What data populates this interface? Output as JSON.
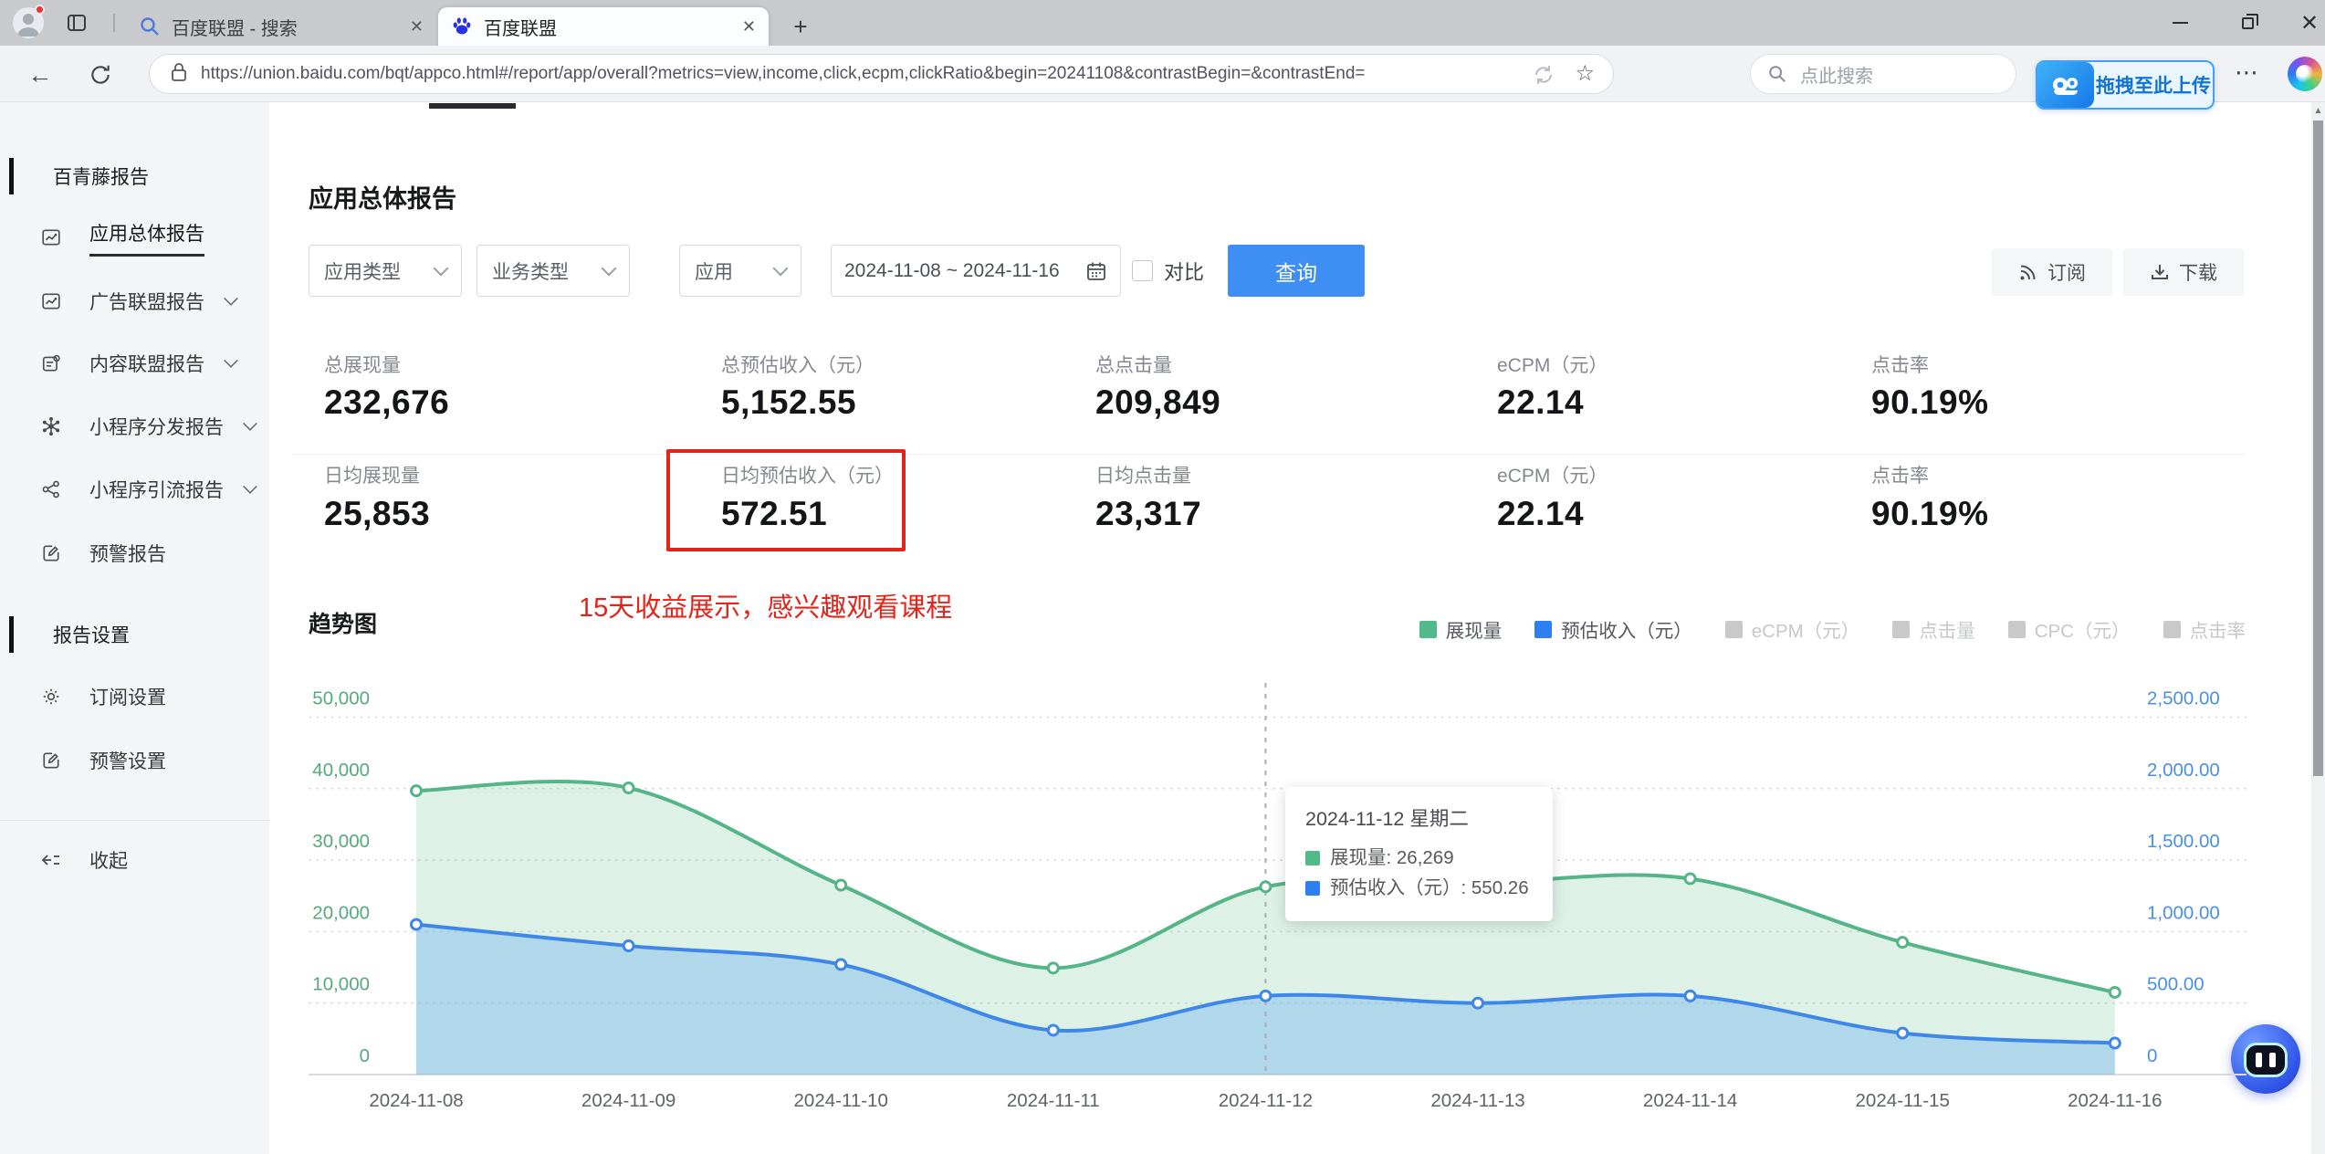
{
  "browser": {
    "tabs": [
      {
        "title": "百度联盟 - 搜索"
      },
      {
        "title": "百度联盟"
      }
    ],
    "url": "https://union.baidu.com/bqt/appco.html#/report/app/overall?metrics=view,income,click,ecpm,clickRatio&begin=20241108&contrastBegin=&contrastEnd=",
    "search_placeholder": "点此搜索",
    "netdisk_button": "拖拽至此上传"
  },
  "sidebar": {
    "sections": [
      {
        "header": "百青藤报告",
        "items": [
          {
            "label": "应用总体报告",
            "icon": "report-chart",
            "active": true,
            "expandable": false
          },
          {
            "label": "广告联盟报告",
            "icon": "report-chart",
            "active": false,
            "expandable": true
          },
          {
            "label": "内容联盟报告",
            "icon": "content-doc",
            "active": false,
            "expandable": true
          },
          {
            "label": "小程序分发报告",
            "icon": "network",
            "active": false,
            "expandable": true
          },
          {
            "label": "小程序引流报告",
            "icon": "share",
            "active": false,
            "expandable": true
          },
          {
            "label": "预警报告",
            "icon": "alert-edit",
            "active": false,
            "expandable": false
          }
        ]
      },
      {
        "header": "报告设置",
        "items": [
          {
            "label": "订阅设置",
            "icon": "gear",
            "active": false,
            "expandable": false
          },
          {
            "label": "预警设置",
            "icon": "alert-edit",
            "active": false,
            "expandable": false
          }
        ]
      }
    ],
    "collapse_label": "收起"
  },
  "main": {
    "title": "应用总体报告",
    "filters": {
      "app_type": "应用类型",
      "biz_type": "业务类型",
      "app": "应用",
      "date_range": "2024-11-08 ~ 2024-11-16",
      "contrast_label": "对比",
      "query_button": "查询"
    },
    "actions": {
      "subscribe": "订阅",
      "download": "下载"
    },
    "stats": {
      "rows": [
        [
          {
            "label": "总展现量",
            "value": "232,676"
          },
          {
            "label": "总预估收入（元）",
            "value": "5,152.55"
          },
          {
            "label": "总点击量",
            "value": "209,849"
          },
          {
            "label": "eCPM（元）",
            "value": "22.14"
          },
          {
            "label": "点击率",
            "value": "90.19%"
          }
        ],
        [
          {
            "label": "日均展现量",
            "value": "25,853"
          },
          {
            "label": "日均预估收入（元）",
            "value": "572.51",
            "highlighted": true
          },
          {
            "label": "日均点击量",
            "value": "23,317"
          },
          {
            "label": "eCPM（元）",
            "value": "22.14"
          },
          {
            "label": "点击率",
            "value": "90.19%"
          }
        ]
      ]
    },
    "annotation": "15天收益展示，感兴趣观看课程",
    "chart_title": "趋势图"
  },
  "chart_data": {
    "type": "area",
    "title": "趋势图",
    "x": [
      "2024-11-08",
      "2024-11-09",
      "2024-11-10",
      "2024-11-11",
      "2024-11-12",
      "2024-11-13",
      "2024-11-14",
      "2024-11-15",
      "2024-11-16"
    ],
    "series": [
      {
        "name": "展现量",
        "axis": "left",
        "color": "#55b588",
        "fill": "rgba(102,190,146,0.22)",
        "values": [
          39700,
          40100,
          26500,
          14900,
          26269,
          26800,
          27400,
          18500,
          11500
        ]
      },
      {
        "name": "预估收入（元）",
        "axis": "right",
        "color": "#3e87e8",
        "fill": "rgba(125,185,240,0.45)",
        "values": [
          1050,
          900,
          770,
          310,
          550.26,
          500,
          550,
          290,
          220
        ]
      }
    ],
    "left_axis": {
      "min": 0,
      "max": 50000,
      "step": 10000,
      "labels": [
        "0",
        "10,000",
        "20,000",
        "30,000",
        "40,000",
        "50,000"
      ],
      "color": "#55a97c"
    },
    "right_axis": {
      "min": 0,
      "max": 2500,
      "step": 500,
      "labels": [
        "0",
        "500.00",
        "1,000.00",
        "1,500.00",
        "2,000.00",
        "2,500.00"
      ],
      "color": "#4a90e2"
    },
    "grid": "dotted horizontal",
    "legend_position": "top-right",
    "legend": [
      {
        "label": "展现量",
        "color": "#52b98a",
        "active": true
      },
      {
        "label": "预估收入（元）",
        "color": "#2e7ff0",
        "active": true
      },
      {
        "label": "eCPM（元）",
        "color": "#c9c9c9",
        "active": false
      },
      {
        "label": "点击量",
        "color": "#c9c9c9",
        "active": false
      },
      {
        "label": "CPC（元）",
        "color": "#c9c9c9",
        "active": false
      },
      {
        "label": "点击率",
        "color": "#c9c9c9",
        "active": false
      }
    ],
    "tooltip": {
      "title": "2024-11-12 星期二",
      "anchor_index": 4,
      "rows": [
        {
          "text": "展现量: 26,269",
          "color": "#52b98a"
        },
        {
          "text": "预估收入（元）: 550.26",
          "color": "#2e7ff0"
        }
      ]
    }
  }
}
